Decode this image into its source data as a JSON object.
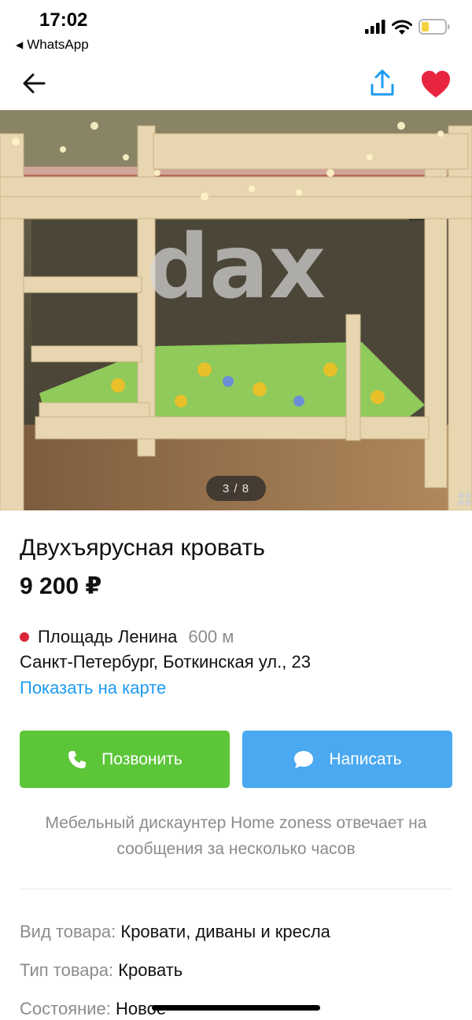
{
  "status_bar": {
    "time": "17:02",
    "back_app": "WhatsApp"
  },
  "photo": {
    "watermark": "dax",
    "counter": "3 / 8"
  },
  "listing": {
    "title": "Двухъярусная кровать",
    "price": "9 200 ₽",
    "metro_station": "Площадь Ленина",
    "metro_distance": "600 м",
    "metro_color": "#d9263b",
    "address": "Санкт-Петербург, Боткинская ул., 23",
    "map_link": "Показать на карте"
  },
  "actions": {
    "call_label": "Позвонить",
    "call_color": "#5cc639",
    "message_label": "Написать",
    "message_color": "#4aa9f0"
  },
  "seller_note": "Мебельный дискаунтер Home zoness отвечает на сообщения за несколько часов",
  "params": [
    {
      "label": "Вид товара:",
      "value": "Кровати, диваны и кресла"
    },
    {
      "label": "Тип товара:",
      "value": "Кровать"
    },
    {
      "label": "Состояние:",
      "value": "Новое"
    }
  ],
  "icons": [
    "back-arrow-icon",
    "share-icon",
    "heart-icon",
    "phone-icon",
    "chat-bubble-icon",
    "signal-icon",
    "wifi-icon",
    "battery-icon"
  ]
}
